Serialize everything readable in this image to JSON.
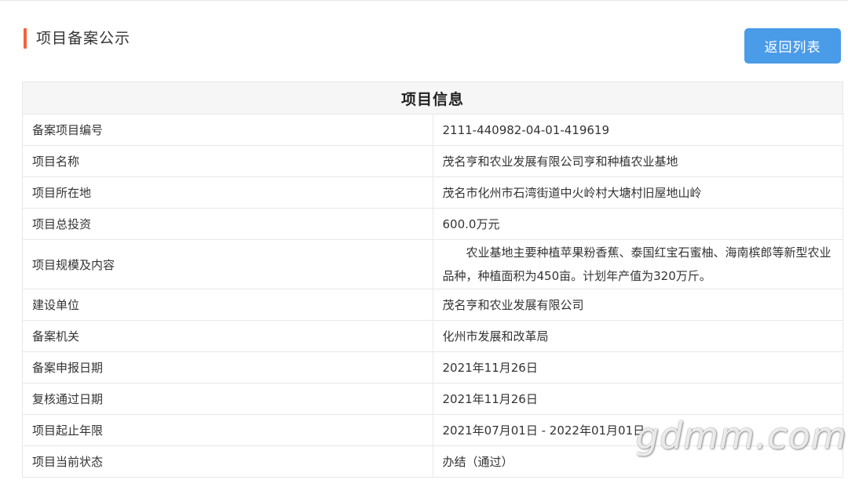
{
  "header": {
    "title": "项目备案公示",
    "back_button": "返回列表"
  },
  "table": {
    "title": "项目信息",
    "rows": [
      {
        "label": "备案项目编号",
        "value": "2111-440982-04-01-419619"
      },
      {
        "label": "项目名称",
        "value": "茂名亨和农业发展有限公司亨和种植农业基地"
      },
      {
        "label": "项目所在地",
        "value": "茂名市化州市石湾街道中火岭村大塘村旧屋地山岭"
      },
      {
        "label": "项目总投资",
        "value": "600.0万元"
      },
      {
        "label": "项目规模及内容",
        "value": "农业基地主要种植苹果粉香蕉、泰国红宝石蜜柚、海南槟郎等新型农业品种，种植面积为450亩。计划年产值为320万斤。"
      },
      {
        "label": "建设单位",
        "value": "茂名亨和农业发展有限公司"
      },
      {
        "label": "备案机关",
        "value": "化州市发展和改革局"
      },
      {
        "label": "备案申报日期",
        "value": "2021年11月26日"
      },
      {
        "label": "复核通过日期",
        "value": "2021年11月26日"
      },
      {
        "label": "项目起止年限",
        "value": "2021年07月01日 - 2022年01月01日"
      },
      {
        "label": "项目当前状态",
        "value": "办结（通过）"
      }
    ]
  },
  "watermark": "gdmm.com"
}
